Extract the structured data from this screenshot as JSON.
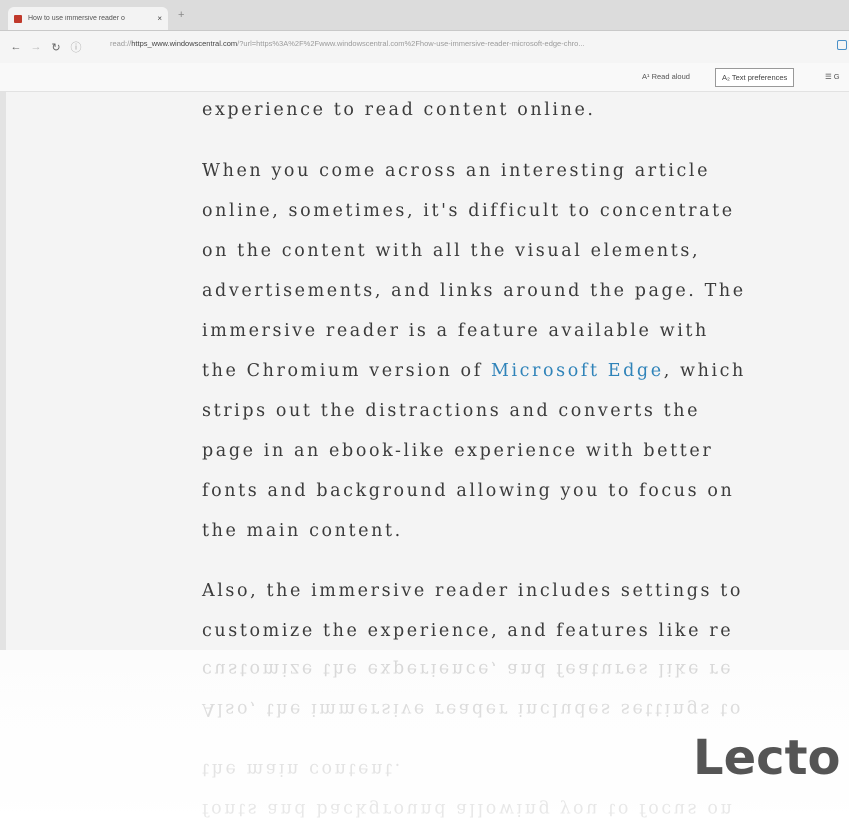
{
  "browser": {
    "tab_title": "How to use immersive reader o",
    "tab_close": "×",
    "new_tab": "+",
    "nav": {
      "back": "←",
      "forward": "→",
      "refresh": "↻",
      "info": "ⓘ"
    },
    "address_prefix": "read://",
    "address_host": "https_www.windowscentral.com",
    "address_rest": "/?url=https%3A%2F%2Fwww.windowscentral.com%2Fhow-use-immersive-reader-microsoft-edge-chro..."
  },
  "reader_toolbar": {
    "read_aloud": "A¹ Read aloud",
    "text_preferences": "A₂ Text preferences",
    "grammar": "☰ G"
  },
  "article": {
    "p0": [
      "experience to read content online."
    ],
    "p1": [
      "When you come across an interesting article",
      "online, sometimes, it's difficult to concentrate",
      "on the content with all the visual elements,",
      "advertisements, and links around the page. The",
      "immersive reader is a feature available with",
      "the Chromium version of ",
      "strips out the distractions and converts the",
      "page in an ebook-like experience with better",
      "fonts and background allowing you to focus on",
      "the main content."
    ],
    "link_text": "Microsoft Edge",
    "after_link": ", which",
    "p2": [
      "Also, the immersive reader includes settings to",
      "customize the experience, and features like re"
    ]
  },
  "overlay": {
    "brand_text": "Lecto"
  },
  "colors": {
    "link": "#2f83b9",
    "text": "#3b3b3b",
    "tab_favicon": "#c0392b"
  }
}
